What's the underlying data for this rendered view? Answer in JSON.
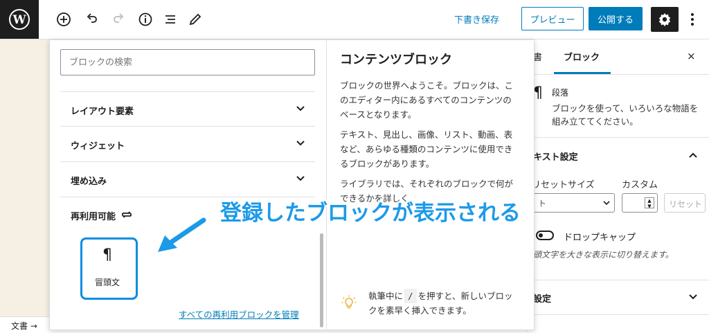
{
  "toolbar": {
    "save_draft": "下書き保存",
    "preview": "プレビュー",
    "publish": "公開する",
    "icons": [
      "wordpress-logo-icon",
      "add-block-icon",
      "undo-icon",
      "redo-icon",
      "info-icon",
      "list-view-icon",
      "edit-tool-icon",
      "gear-icon",
      "more-vertical-icon"
    ]
  },
  "inserter": {
    "search_placeholder": "ブロックの検索",
    "categories": [
      {
        "label": "レイアウト要素"
      },
      {
        "label": "ウィジェット"
      },
      {
        "label": "埋め込み"
      }
    ],
    "reusable": {
      "label": "再利用可能",
      "block_label": "冒頭文",
      "manage_link": "すべての再利用ブロックを管理"
    },
    "preview": {
      "title": "コンテンツブロック",
      "paragraphs": [
        "ブロックの世界へようこそ。ブロックは、このエディター内にあるすべてのコンテンツのベースとなります。",
        "テキスト、見出し、画像、リスト、動画、表など、あらゆる種類のコンテンツに使用できるブロックがあります。",
        "ライブラリでは、それぞれのブロックで何ができるかを詳しく"
      ],
      "tip_before": "執筆中に",
      "tip_key": "/",
      "tip_after": "を押すと、新しいブロックを素早く挿入できます。"
    }
  },
  "sidebar": {
    "tab_document": "書",
    "tab_block": "ブロック",
    "close": "×",
    "block_name": "段落",
    "block_description": "ブロックを使って、いろいろな物語を組み立ててください。",
    "text_settings": "キスト設定",
    "preset_size": "リセットサイズ",
    "custom": "カスタム",
    "preset_value": "ト",
    "reset": "リセット",
    "dropcap": "ドロップキャップ",
    "dropcap_desc": "頭文字を大きな表示に切り替えます。",
    "color_settings": "設定"
  },
  "footer": {
    "breadcrumb": "文書 →"
  },
  "annotation": {
    "text": "登録したブロックが表示される",
    "color": "#1c9ae8"
  }
}
